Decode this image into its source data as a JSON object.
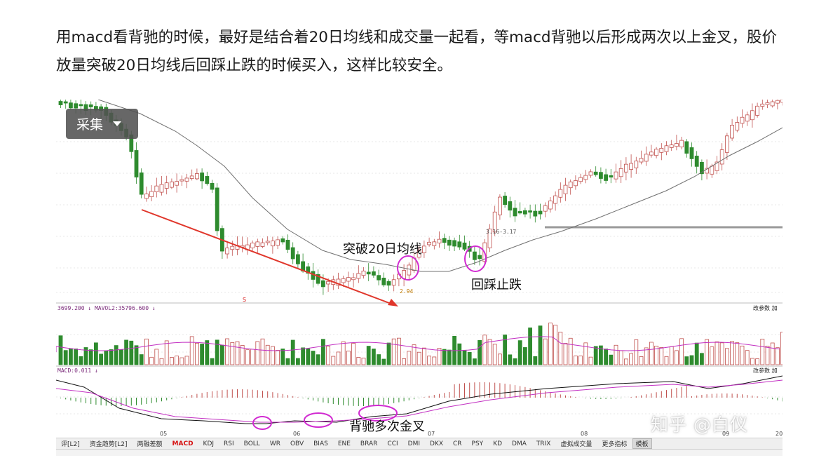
{
  "article": {
    "paragraph": "用macd看背驰的时候，最好是结合着20日均线和成交量一起看，等macd背驰以后形成两次以上金叉，股价放量突破20日均线后回踩止跌的时候买入，这样比较安全。"
  },
  "chart": {
    "collect_button": "采集",
    "annotations": {
      "breakout": "突破20日均线",
      "pullback": "回踩止跌",
      "golden_cross": "背驰多次金叉",
      "low_price": "2.94",
      "range_label": "3.16-3.17",
      "s_marker": "S"
    },
    "volume_header": {
      "left": "3699.200 ↓ MAVOL2:35796.600 ↓",
      "right": "改参数 加"
    },
    "macd_header": {
      "left": "MACD:0.011 ↓",
      "right": "改参数 加"
    },
    "time_labels": [
      "05",
      "06",
      "07",
      "08",
      "09",
      "20"
    ],
    "colors": {
      "up": "#c0504d",
      "down": "#2e8b2e",
      "ma": "#666666",
      "trend_arrow": "#e0362b",
      "circle": "#d12ad1"
    }
  },
  "tabs": [
    "评[L2]",
    "资金趋势[L2]",
    "两融差额",
    "MACD",
    "KDJ",
    "RSI",
    "BOLL",
    "WR",
    "OBV",
    "BIAS",
    "ENE",
    "BRAR",
    "CCI",
    "DMI",
    "DKX",
    "CR",
    "PSY",
    "KD",
    "DMA",
    "TRIX",
    "虚拟成交量",
    "更多指标",
    "模板"
  ],
  "active_tab": "MACD",
  "watermark": "知乎 @白仪"
}
